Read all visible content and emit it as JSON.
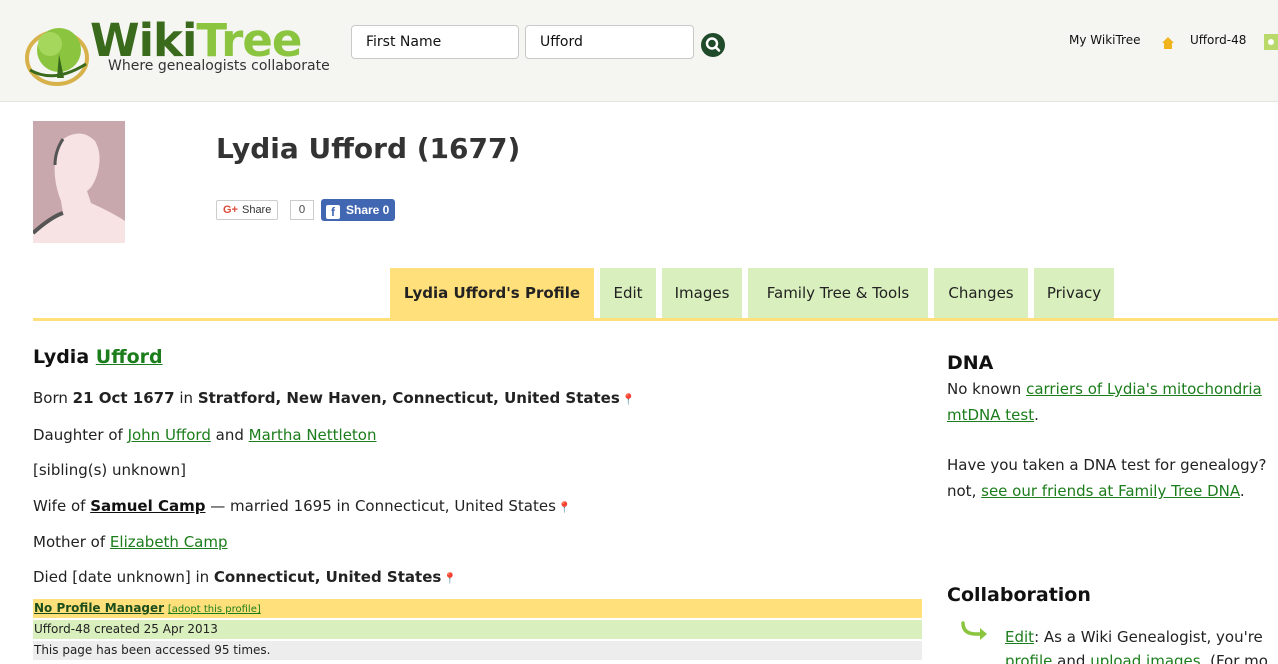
{
  "header": {
    "logo_word_a": "Wiki",
    "logo_word_b": "Tree",
    "logo_tagline": "Where genealogists collaborate",
    "search_first_name": "First Name",
    "search_last_name": "Ufford",
    "my_wikitree": "My WikiTree",
    "user_id": "Ufford-48"
  },
  "profile": {
    "title": "Lydia Ufford (1677)",
    "gplus_share": "Share",
    "gplus_count": "0",
    "fb_share": "Share 0"
  },
  "tabs": [
    {
      "label": "Lydia Ufford's Profile",
      "active": true
    },
    {
      "label": "Edit"
    },
    {
      "label": "Images"
    },
    {
      "label": "Family Tree & Tools"
    },
    {
      "label": "Changes"
    },
    {
      "label": "Privacy"
    }
  ],
  "person": {
    "first_name": "Lydia",
    "last_name": "Ufford",
    "born_prefix": "Born",
    "born_date": "21 Oct 1677",
    "born_in": "in",
    "born_place": "Stratford, New Haven, Connecticut, United States",
    "daughter_of": "Daughter of",
    "father": "John Ufford",
    "and": "and",
    "mother": "Martha Nettleton",
    "siblings": "[sibling(s) unknown]",
    "wife_of": "Wife of",
    "spouse": "Samuel Camp",
    "married": "— married 1695 in Connecticut, United States",
    "mother_of": "Mother of",
    "child": "Elizabeth Camp",
    "died_prefix": "Died [date unknown] in",
    "died_place": "Connecticut, United States",
    "no_manager": "No Profile Manager",
    "adopt": "[adopt this profile]",
    "created": "Ufford-48 created 25 Apr 2013",
    "accessed": "This page has been accessed 95 times."
  },
  "sidebar": {
    "dna_heading": "DNA",
    "dna_line1_prefix": "No known",
    "dna_line1_link": "carriers of Lydia's mitochondria",
    "dna_line2_link": "mtDNA test",
    "dna_line2_suffix": ".",
    "dna_q_line1": "Have you taken a DNA test for genealogy?",
    "dna_q_line2_prefix": "not,",
    "dna_q_line2_link": "see our friends at Family Tree DNA",
    "dna_q_line2_suffix": ".",
    "collab_heading": "Collaboration",
    "collab_edit_link": "Edit",
    "collab_line1": ": As a Wiki Genealogist, you're",
    "collab_line2_link_a": "profile",
    "collab_line2_and": "and",
    "collab_line2_link_b": "upload images",
    "collab_line2_suffix": ". (For mo"
  },
  "colors": {
    "accent_green": "#1b7d1b",
    "tab_green": "#d9efbd",
    "tab_yellow": "#ffe07a"
  },
  "icons": [
    "tree-logo-icon",
    "search-icon",
    "home-icon",
    "gear-icon",
    "map-pin-icon",
    "arrow-right-icon",
    "facebook-icon",
    "google-plus-icon"
  ]
}
